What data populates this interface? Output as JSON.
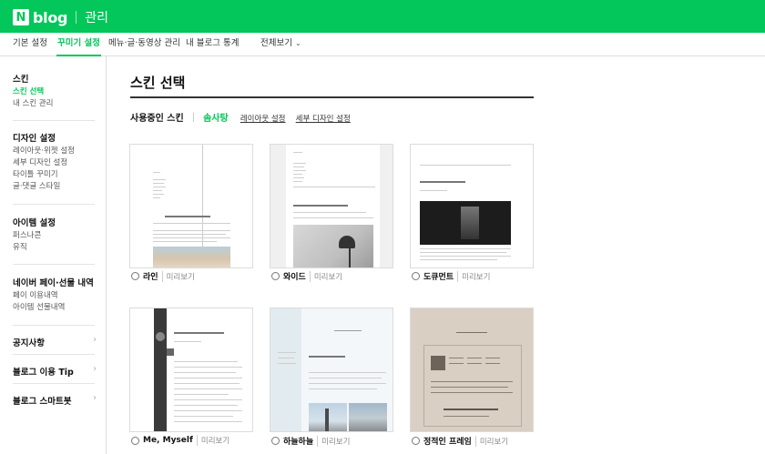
{
  "header": {
    "logo_badge": "N",
    "logo_text": "blog",
    "section": "관리"
  },
  "tabs": [
    {
      "label": "기본 설정"
    },
    {
      "label": "꾸미기 설정"
    },
    {
      "label": "메뉴·글·동영상 관리"
    },
    {
      "label": "내 블로그 통계"
    },
    {
      "label": "전체보기"
    }
  ],
  "sidebar": {
    "skin": {
      "title": "스킨",
      "items": [
        "스킨 선택",
        "내 스킨 관리"
      ]
    },
    "design": {
      "title": "디자인 설정",
      "items": [
        "레이아웃·위젯 설정",
        "세부 디자인 설정",
        "타이틀 꾸미기",
        "글·댓글 스타일"
      ]
    },
    "items": {
      "title": "아이템 설정",
      "items": [
        "퍼스나콘",
        "유직"
      ]
    },
    "pay": {
      "title": "네이버 페이·선물 내역",
      "items": [
        "페이 이용내역",
        "아이템 선물내역"
      ]
    },
    "links": [
      "공지사항",
      "블로그 이용 Tip",
      "블로그 스마트봇"
    ]
  },
  "main": {
    "title": "스킨 선택",
    "in_use_label": "사용중인 스킨",
    "in_use_name": "솜사탕",
    "layout_link": "레이아웃 설정",
    "detail_link": "세부 디자인 설정"
  },
  "skins": [
    {
      "name": "라인",
      "preview": "미리보기"
    },
    {
      "name": "와이드",
      "preview": "미리보기"
    },
    {
      "name": "도큐먼트",
      "preview": "미리보기"
    },
    {
      "name": "Me, Myself",
      "preview": "미리보기"
    },
    {
      "name": "하늘하늘",
      "preview": "미리보기"
    },
    {
      "name": "정적인 프레임",
      "preview": "미리보기"
    }
  ],
  "colors": {
    "brand": "#03c75a"
  },
  "icons": {
    "tab_chevron": "chevron-down-icon",
    "sidebar_arrow": "chevron-right-icon"
  }
}
